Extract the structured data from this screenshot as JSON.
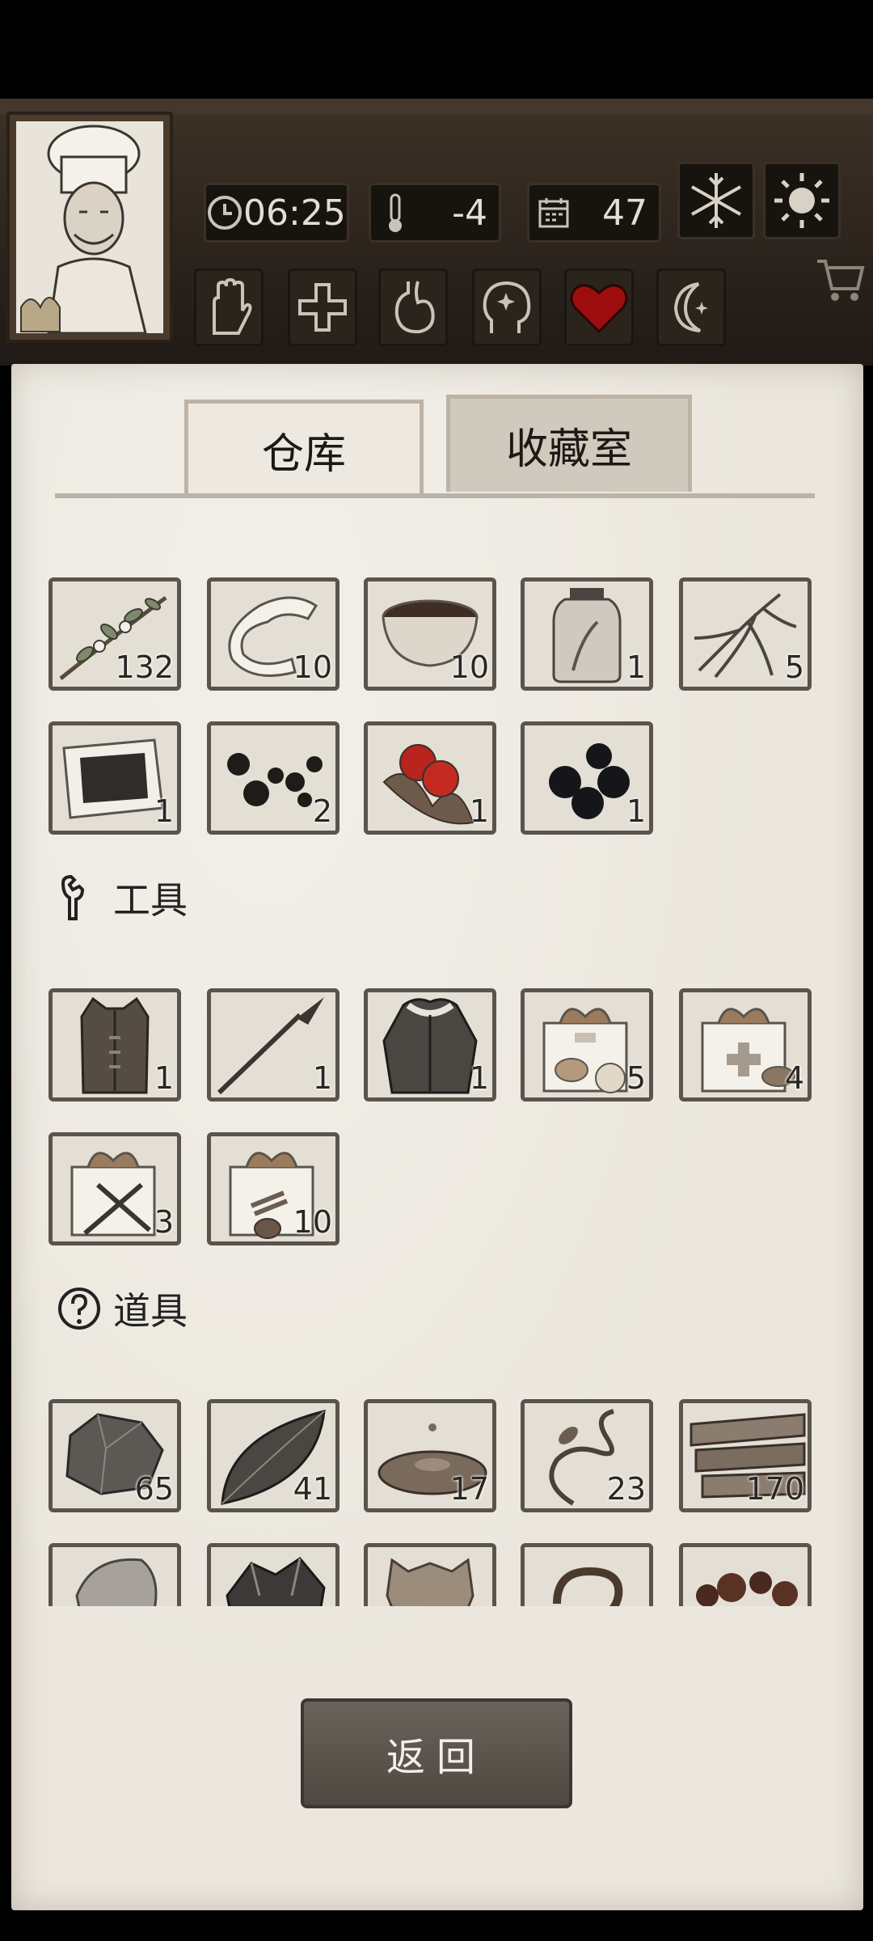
{
  "hud": {
    "time": "06:25",
    "temperature": "-4",
    "day": "47"
  },
  "tabs": [
    "仓库",
    "收藏室"
  ],
  "sections": {
    "tools": "工具",
    "props": "道具"
  },
  "inventory": {
    "ingredients": [
      {
        "icon": "herb-branch-icon",
        "qty": "132"
      },
      {
        "icon": "bandage-icon",
        "qty": "10"
      },
      {
        "icon": "bowl-icon",
        "qty": "10"
      },
      {
        "icon": "jar-icon",
        "qty": "1"
      },
      {
        "icon": "ginseng-root-icon",
        "qty": "5"
      },
      {
        "icon": "plaster-icon",
        "qty": "1"
      },
      {
        "icon": "black-pills-icon",
        "qty": "2"
      },
      {
        "icon": "red-berries-icon",
        "qty": "1"
      },
      {
        "icon": "black-berries-icon",
        "qty": "1"
      }
    ],
    "tools": [
      {
        "icon": "leather-vest-icon",
        "qty": "1"
      },
      {
        "icon": "spear-icon",
        "qty": "1"
      },
      {
        "icon": "fur-coat-icon",
        "qty": "1"
      },
      {
        "icon": "food-gift-box-icon",
        "qty": "5"
      },
      {
        "icon": "medical-gift-box-icon",
        "qty": "4"
      },
      {
        "icon": "weapon-gift-box-icon",
        "qty": "3"
      },
      {
        "icon": "material-gift-box-icon",
        "qty": "10"
      }
    ],
    "props": [
      {
        "icon": "stone-icon",
        "qty": "65"
      },
      {
        "icon": "leaf-icon",
        "qty": "41"
      },
      {
        "icon": "mud-puddle-icon",
        "qty": "17"
      },
      {
        "icon": "vine-icon",
        "qty": "23"
      },
      {
        "icon": "wood-planks-icon",
        "qty": "170"
      },
      {
        "icon": "rock-icon",
        "qty": ""
      },
      {
        "icon": "ore-icon",
        "qty": ""
      },
      {
        "icon": "hide-icon",
        "qty": ""
      },
      {
        "icon": "rope-icon",
        "qty": ""
      },
      {
        "icon": "resin-icon",
        "qty": ""
      }
    ]
  },
  "back_button": "返回"
}
